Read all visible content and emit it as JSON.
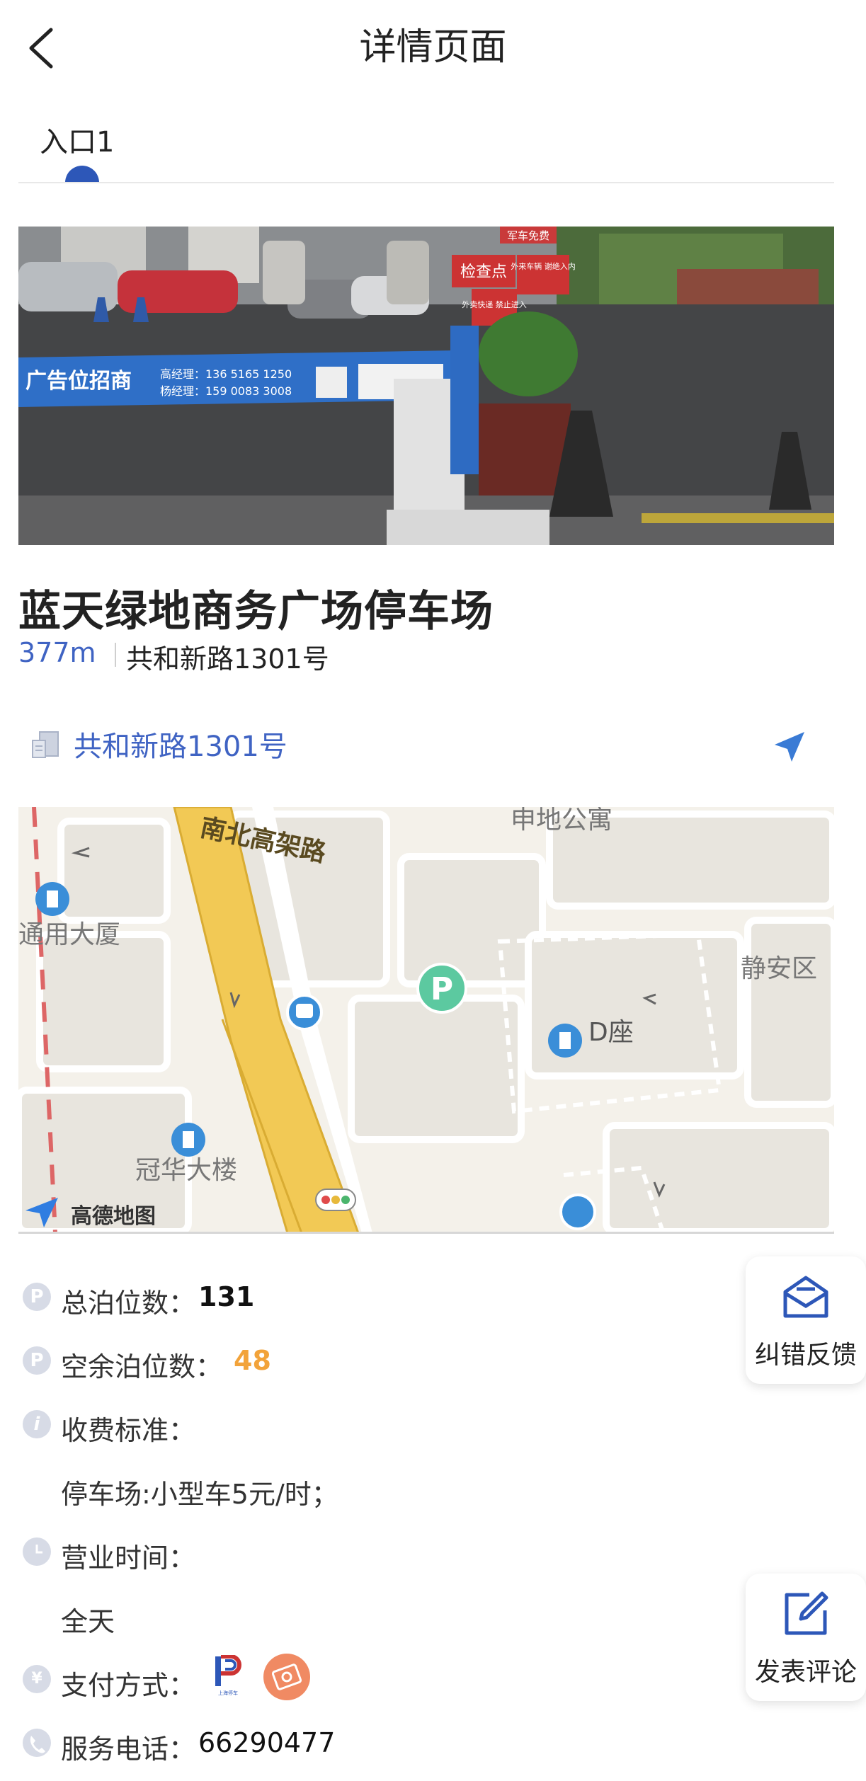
{
  "header": {
    "title": "详情页面"
  },
  "tabs": [
    {
      "label": "入口1",
      "active": true
    }
  ],
  "parking": {
    "name": "蓝天绿地商务广场停车场",
    "distance": "377m",
    "address": "共和新路1301号"
  },
  "address_row": {
    "text": "共和新路1301号"
  },
  "photo": {
    "banner_text": "广告位招商",
    "contact_1": "高经理：136 5165 1250",
    "contact_2": "杨经理：159 0083 3008",
    "sign_1": "检查点",
    "sign_2": "外来车辆 谢绝入内",
    "sign_3": "军车免费",
    "sign_4": "外卖快递 禁止进入"
  },
  "map": {
    "road_label": "南北高架路",
    "labels": {
      "shendi": "申地公寓",
      "jingan": "静安区",
      "dzuo": "D座",
      "yongda": "通用大厦",
      "guanhua": "冠华大楼"
    },
    "brand": "高德地图",
    "parking_marker": "P"
  },
  "info": {
    "total_label": "总泊位数：",
    "total_value": "131",
    "free_label": "空余泊位数：",
    "free_value": "48",
    "fee_label": "收费标准：",
    "fee_value": "停车场:小型车5元/时；",
    "hours_label": "营业时间：",
    "hours_value": "全天",
    "pay_label": "支付方式：",
    "pay_logo_text": "上海停车",
    "phone_label": "服务电话：",
    "phone_value": "66290477"
  },
  "floating": {
    "feedback_label": "纠错反馈",
    "comment_label": "发表评论"
  },
  "colors": {
    "accent": "#3f63c3",
    "tab_indicator": "#2d57b8",
    "orange": "#f2a33a",
    "parking_green": "#5cc9a0"
  }
}
